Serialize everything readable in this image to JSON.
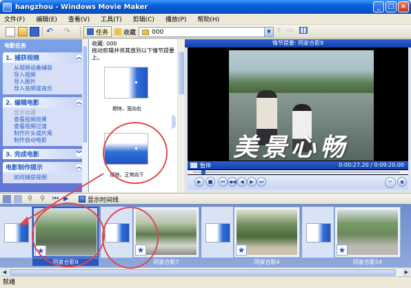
{
  "window": {
    "title": "hangzhou - Windows Movie Maker"
  },
  "menu": [
    "文件(F)",
    "编辑(E)",
    "查看(V)",
    "工具(T)",
    "剪辑(C)",
    "播放(P)",
    "帮助(H)"
  ],
  "toolbar": {
    "tasks_label": "任务",
    "collections_label": "收藏",
    "collection_path": "000"
  },
  "task_pane": {
    "header": "电影任务",
    "sections": [
      {
        "title": "1. 捕获视频",
        "links": [
          "从视频设备捕获",
          "导入视频",
          "导入图片",
          "导入音频或音乐"
        ]
      },
      {
        "title": "2. 编辑电影",
        "links": [
          "显示收藏",
          "查看视频效果",
          "查看视频过渡",
          "制作片头或片尾",
          "制作自动电影"
        ],
        "dim_first": true
      },
      {
        "title": "3. 完成电影",
        "links": []
      },
      {
        "title": "电影制作提示",
        "links": [
          "如何捕获视频"
        ]
      }
    ]
  },
  "collection": {
    "header_line1": "收藏: 000",
    "header_line2": "拖动剪辑并将其放到以下情节提要上。",
    "transitions": [
      {
        "label": "擦除，宽向右"
      },
      {
        "label": "擦除，正常向下"
      }
    ]
  },
  "monitor": {
    "title": "情节提要: 同家合影9",
    "overlay_text": "美景心畅",
    "state": "暂停",
    "time": "0:00:27.20 / 0:09:20.00"
  },
  "storyboard": {
    "timeline_toggle": "显示时间线",
    "clips": [
      {
        "label": "同家合影9",
        "selected": true
      },
      {
        "label": "同家合影7",
        "selected": false
      },
      {
        "label": "同家合影4",
        "selected": false
      },
      {
        "label": "同家合影54",
        "selected": false
      }
    ]
  },
  "status": {
    "text": "就绪"
  }
}
